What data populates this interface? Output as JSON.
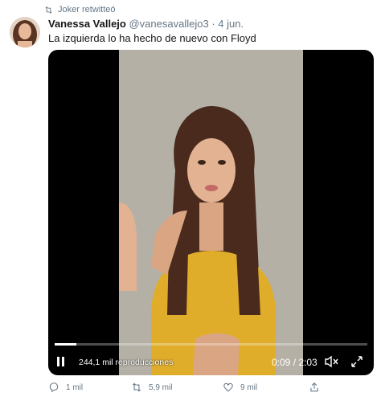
{
  "retweet": {
    "label": "Joker retwitteó"
  },
  "tweet": {
    "author_name": "Vanessa Vallejo",
    "handle": "@vanesavallejo3",
    "separator": "·",
    "date": "4 jun.",
    "text": "La izquierda lo ha hecho de nuevo con Floyd"
  },
  "video": {
    "views": "244,1 mil reproducciones",
    "time": "0:09 / 2:03",
    "progress": 0.07
  },
  "actions": {
    "reply_count": "1 mil",
    "retweet_count": "5,9 mil",
    "like_count": "9 mil"
  },
  "colors": {
    "text_primary": "#14171a",
    "text_secondary": "#657786",
    "video_background": "#000000",
    "shirt": "#e0ad2a"
  }
}
